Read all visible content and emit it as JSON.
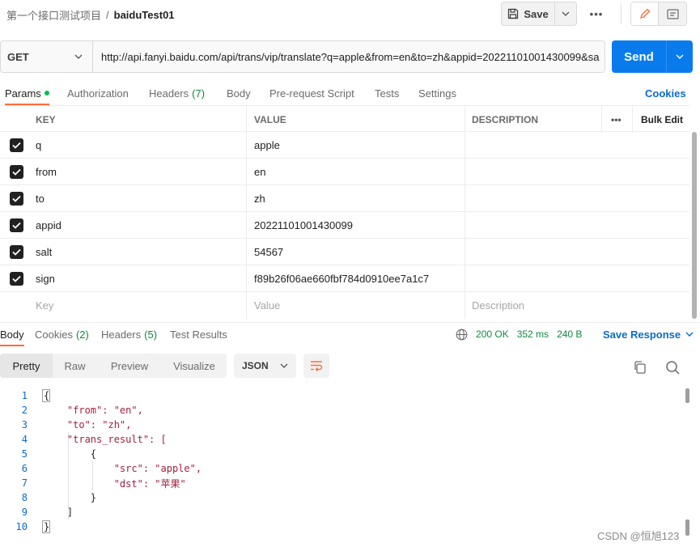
{
  "header": {
    "collection": "第一个接口测试项目",
    "separator": "/",
    "request_name": "baiduTest01",
    "save_label": "Save",
    "more_label": "•••"
  },
  "request": {
    "method": "GET",
    "url": "http://api.fanyi.baidu.com/api/trans/vip/translate?q=apple&from=en&to=zh&appid=20221101001430099&sa",
    "send_label": "Send"
  },
  "tabs": [
    {
      "label": "Params",
      "count": ""
    },
    {
      "label": "Authorization",
      "count": ""
    },
    {
      "label": "Headers",
      "count": "(7)"
    },
    {
      "label": "Body",
      "count": ""
    },
    {
      "label": "Pre-request Script",
      "count": ""
    },
    {
      "label": "Tests",
      "count": ""
    },
    {
      "label": "Settings",
      "count": ""
    }
  ],
  "cookies_label": "Cookies",
  "params": {
    "columns": [
      "KEY",
      "VALUE",
      "DESCRIPTION"
    ],
    "more_label": "•••",
    "bulk_edit_label": "Bulk Edit",
    "rows": [
      {
        "key": "q",
        "value": "apple",
        "description": "",
        "checked": true
      },
      {
        "key": "from",
        "value": "en",
        "description": "",
        "checked": true
      },
      {
        "key": "to",
        "value": "zh",
        "description": "",
        "checked": true
      },
      {
        "key": "appid",
        "value": "20221101001430099",
        "description": "",
        "checked": true
      },
      {
        "key": "salt",
        "value": "54567",
        "description": "",
        "checked": true
      },
      {
        "key": "sign",
        "value": "f89b26f06ae660fbf784d0910ee7a1c7",
        "description": "",
        "checked": true
      }
    ],
    "placeholders": {
      "key": "Key",
      "value": "Value",
      "description": "Description"
    }
  },
  "response": {
    "tabs": [
      {
        "label": "Body",
        "count": ""
      },
      {
        "label": "Cookies",
        "count": "(2)"
      },
      {
        "label": "Headers",
        "count": "(5)"
      },
      {
        "label": "Test Results",
        "count": ""
      }
    ],
    "status": "200 OK",
    "time": "352 ms",
    "size": "240 B",
    "save_response_label": "Save Response",
    "format_tabs": [
      "Pretty",
      "Raw",
      "Preview",
      "Visualize"
    ],
    "format": "JSON",
    "code_lines": [
      "{",
      "    \"from\": \"en\",",
      "    \"to\": \"zh\",",
      "    \"trans_result\": [",
      "        {",
      "            \"src\": \"apple\",",
      "            \"dst\": \"苹果\"",
      "        }",
      "    ]",
      "}"
    ]
  },
  "watermark": "CSDN @恒旭123",
  "colors": {
    "accent": "#ff6c37",
    "send": "#097bed",
    "link": "#0b6bcb",
    "ok": "#0f8a3f"
  }
}
